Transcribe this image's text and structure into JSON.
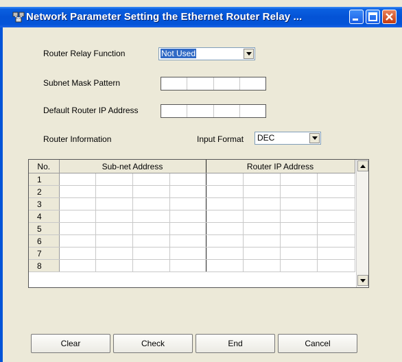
{
  "window": {
    "title": "Network Parameter  Setting the Ethernet Router Relay ...",
    "accent": "#0454d8"
  },
  "form": {
    "router_relay_label": "Router Relay Function",
    "router_relay_value": "Not Used",
    "subnet_mask_label": "Subnet Mask Pattern",
    "default_router_label": "Default Router IP Address",
    "router_info_label": "Router Information",
    "input_format_label": "Input Format",
    "input_format_value": "DEC"
  },
  "grid": {
    "col_no": "No.",
    "col_subnet": "Sub-net Address",
    "col_router": "Router IP Address",
    "rows": [
      "1",
      "2",
      "3",
      "4",
      "5",
      "6",
      "7",
      "8"
    ]
  },
  "buttons": {
    "clear": "Clear",
    "check": "Check",
    "end": "End",
    "cancel": "Cancel"
  }
}
